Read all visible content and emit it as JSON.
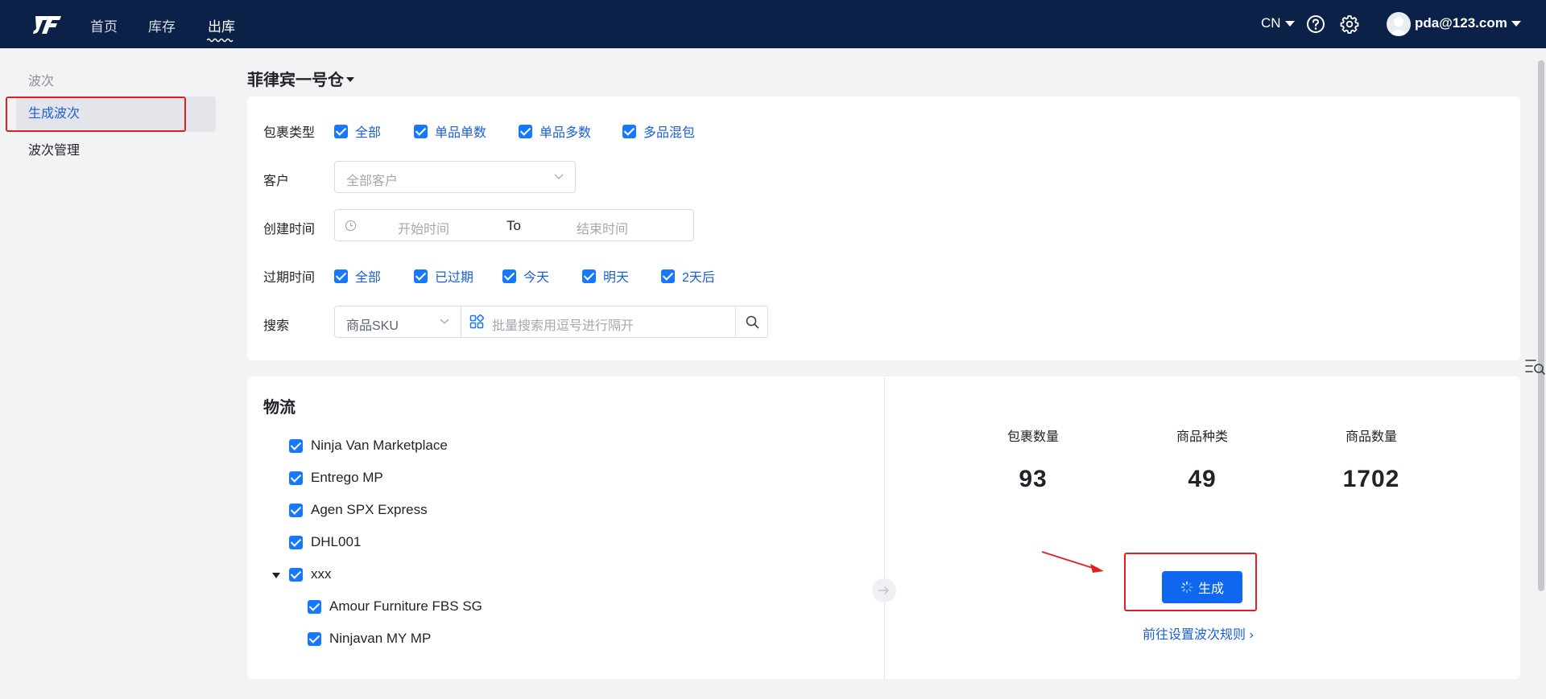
{
  "nav": {
    "items": [
      "首页",
      "库存",
      "出库"
    ],
    "active_index": 2,
    "lang": "CN",
    "user": "pda@123.com",
    "icons": [
      "help-icon",
      "settings-icon"
    ]
  },
  "sidebar": {
    "group": "波次",
    "items": [
      "生成波次",
      "波次管理"
    ],
    "active_index": 0
  },
  "warehouse": "菲律宾一号仓",
  "filters": {
    "package_type": {
      "label": "包裹类型",
      "options": [
        "全部",
        "单品单数",
        "单品多数",
        "多品混包"
      ]
    },
    "customer": {
      "label": "客户",
      "placeholder": "全部客户"
    },
    "created_time": {
      "label": "创建时间",
      "start_placeholder": "开始时间",
      "separator": "To",
      "end_placeholder": "结束时间"
    },
    "expire_time": {
      "label": "过期时间",
      "options": [
        "全部",
        "已过期",
        "今天",
        "明天",
        "2天后"
      ]
    },
    "search": {
      "label": "搜索",
      "field": "商品SKU",
      "placeholder": "批量搜索用逗号进行隔开"
    }
  },
  "logistics": {
    "title": "物流",
    "items": [
      "Ninja Van Marketplace",
      "Entrego MP",
      "Agen SPX Express",
      "DHL001"
    ],
    "group": {
      "name": "xxx",
      "children": [
        "Amour Furniture FBS SG",
        "Ninjavan MY MP"
      ]
    }
  },
  "stats": [
    {
      "label": "包裹数量",
      "value": "93"
    },
    {
      "label": "商品种类",
      "value": "49"
    },
    {
      "label": "商品数量",
      "value": "1702"
    }
  ],
  "actions": {
    "generate": "生成",
    "rule_link": "前往设置波次规则 ›"
  },
  "colors": {
    "nav_bg": "#0b2148",
    "primary": "#0f67f0",
    "highlight": "#e02020"
  }
}
